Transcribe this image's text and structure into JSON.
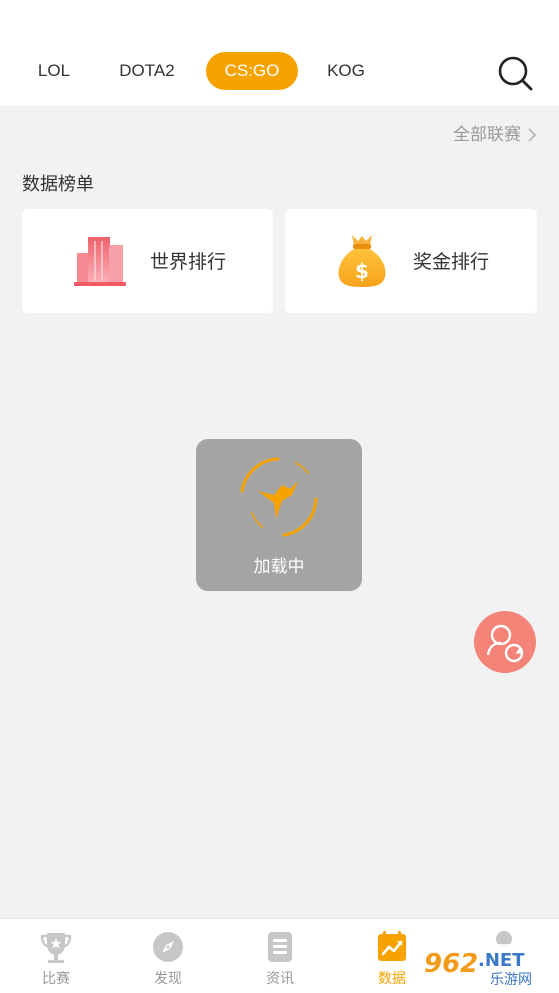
{
  "tabs": [
    {
      "label": "LOL",
      "active": false
    },
    {
      "label": "DOTA2",
      "active": false
    },
    {
      "label": "CS:GO",
      "active": true
    },
    {
      "label": "KOG",
      "active": false
    }
  ],
  "search": {
    "icon": "search-icon"
  },
  "all_leagues": {
    "label": "全部联赛",
    "icon": "chevron-right-icon"
  },
  "section": {
    "title": "数据榜单"
  },
  "cards": [
    {
      "label": "世界排行",
      "icon": "building-chart-icon"
    },
    {
      "label": "奖金排行",
      "icon": "money-bag-icon"
    }
  ],
  "loading": {
    "label": "加载中",
    "icon": "hummingbird-spinner-icon"
  },
  "float_button": {
    "icon": "refresh-user-icon"
  },
  "bottom_nav": [
    {
      "label": "比赛",
      "icon": "trophy-icon",
      "active": false
    },
    {
      "label": "发现",
      "icon": "compass-icon",
      "active": false
    },
    {
      "label": "资讯",
      "icon": "news-icon",
      "active": false
    },
    {
      "label": "数据",
      "icon": "chart-icon",
      "active": true
    },
    {
      "label": "",
      "icon": "user-icon",
      "active": false
    }
  ],
  "watermark": {
    "number": "962",
    "suffix": ".NET",
    "site": "乐游网"
  },
  "colors": {
    "accent": "#f6a300",
    "background": "#f2f2f2",
    "muted": "#999999",
    "float": "#f38477"
  }
}
